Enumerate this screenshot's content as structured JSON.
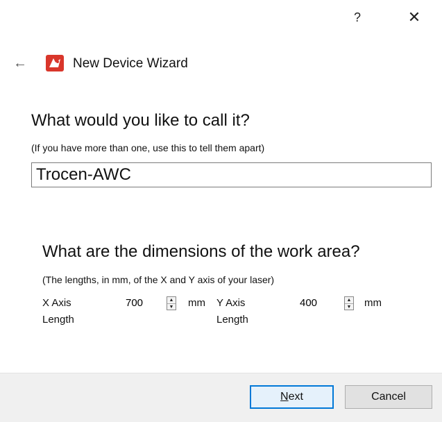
{
  "titlebar": {
    "help_label": "?",
    "close_label": "✕"
  },
  "header": {
    "back_label": "←",
    "title": "New Device Wizard",
    "logo_icon": "red-laser-head-icon"
  },
  "name_section": {
    "question": "What would you like to call it?",
    "hint": "(If you have more than one, use this to tell them apart)",
    "value": "Trocen-AWC"
  },
  "dims_section": {
    "question": "What are the dimensions of the work area?",
    "hint": "(The lengths, in mm, of the X and Y axis of your laser)",
    "x_label": "X Axis Length",
    "x_value": "700",
    "x_unit": "mm",
    "y_label": "Y Axis Length",
    "y_value": "400",
    "y_unit": "mm"
  },
  "footer": {
    "next_mnemonic": "N",
    "next_rest": "ext",
    "cancel_label": "Cancel"
  },
  "colors": {
    "accent": "#0078d7",
    "footer_bg": "#f0f0f0",
    "logo_red": "#d9362b"
  }
}
